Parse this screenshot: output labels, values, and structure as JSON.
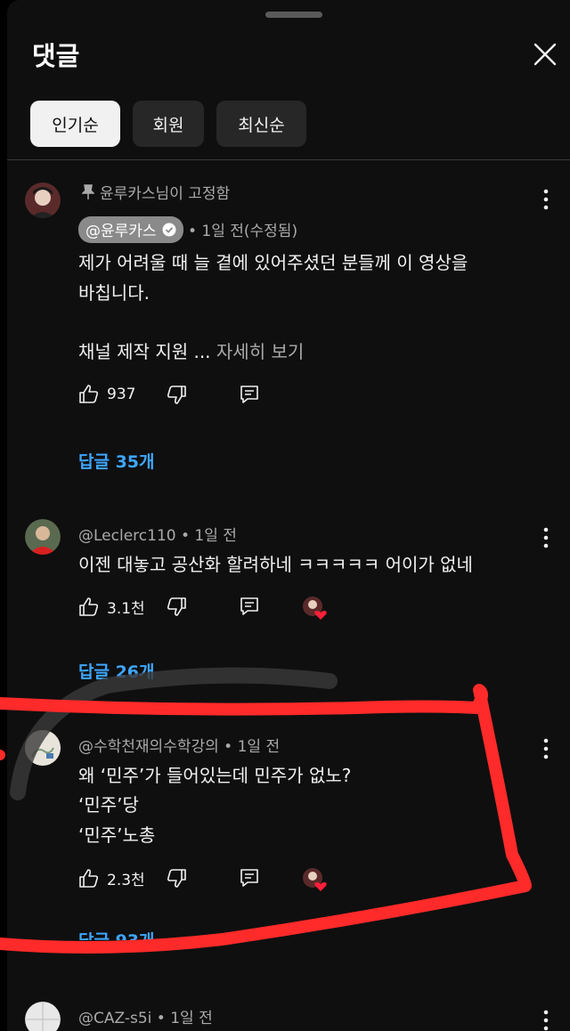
{
  "header": {
    "title": "댓글",
    "close_icon": "close-icon"
  },
  "chips": [
    {
      "label": "인기순",
      "active": true
    },
    {
      "label": "회원",
      "active": false
    },
    {
      "label": "최신순",
      "active": false
    }
  ],
  "comments": [
    {
      "pinned_text": "윤루카스님이 고정함",
      "author": "@윤루카스",
      "verified": true,
      "time": "• 1일 전(수정됨)",
      "lines": [
        "제가 어려울 때 늘 곁에 있어주셨던 분들께 이 영상을",
        "바칩니다.",
        "",
        "채널 제작 지원 ..."
      ],
      "more_label": "자세히 보기",
      "likes": "937",
      "replies": "답글 35개"
    },
    {
      "author": "@Leclerc110",
      "time": "• 1일 전",
      "lines": [
        "이젠 대놓고 공산화 할려하네 ㅋㅋㅋㅋㅋ 어이가 없네"
      ],
      "likes": "3.1천",
      "replies": "답글 26개"
    },
    {
      "author": "@수학천재의수학강의",
      "time": "• 1일 전",
      "lines": [
        "왜 ‘민주’가 들어있는데 민주가 없노?",
        "‘민주’당",
        "‘민주’노총"
      ],
      "likes": "2.3천",
      "replies": "답글 93개"
    },
    {
      "author": "@CAZ-s5i",
      "time": "• 1일 전"
    }
  ],
  "colors": {
    "accent": "#3ea6ff",
    "background": "#0f0f0f",
    "highlight": "#ff2a2a"
  }
}
